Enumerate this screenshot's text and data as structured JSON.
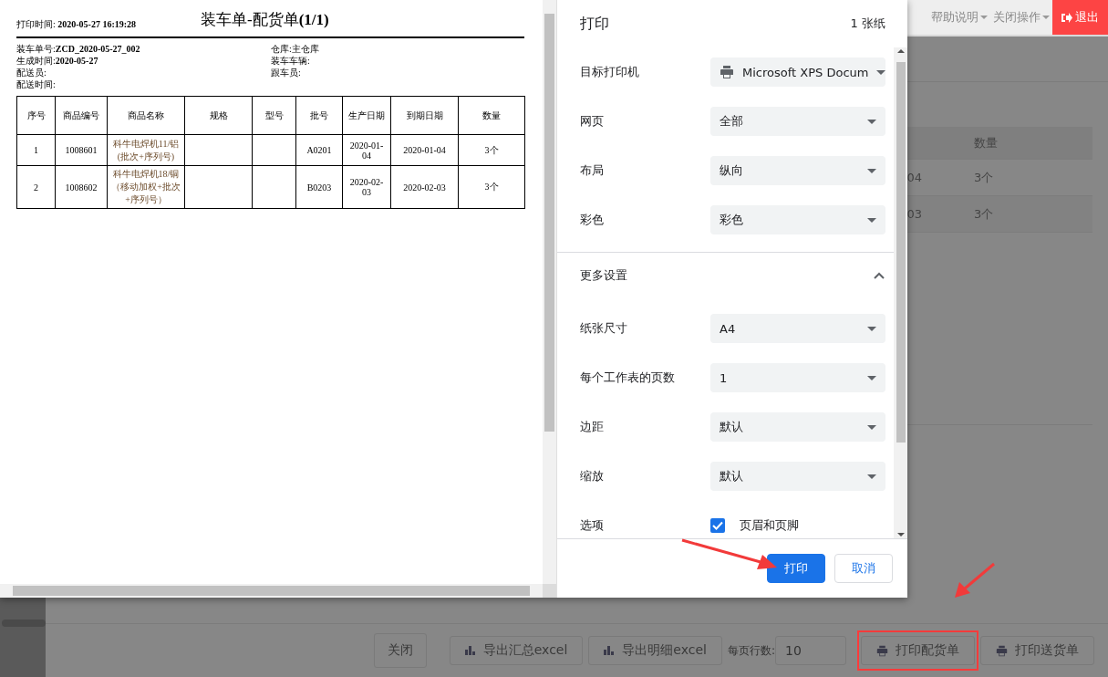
{
  "top_bar": {
    "menus": [
      {
        "label": "帮助说明",
        "dropdown": true
      },
      {
        "label": "关闭操作",
        "dropdown": true
      }
    ],
    "exit": "退出"
  },
  "background_table": {
    "columns": [
      "数量"
    ],
    "rows": [
      {
        "column_1": "04",
        "column_2": "3个"
      },
      {
        "column_1": "03",
        "column_2": "3个"
      }
    ]
  },
  "toolbar": {
    "close": "关闭",
    "export_buttons": [
      "导出汇总excel",
      "导出明细excel"
    ],
    "rows_per_page": {
      "label": "每页行数:",
      "value": "10"
    },
    "print_buttons": [
      {
        "label": "打印配货单",
        "highlighted": true
      },
      {
        "label": "打印送货单",
        "highlighted": false
      }
    ]
  },
  "print_preview": {
    "print_time": "打印时间: **2020-05-27 16:19:28**",
    "title": "装车单-配货单**(1/1)**",
    "info_left": [
      "装车单号:**ZCD_2020-05-27_002**",
      "生成时间:**2020-05-27**",
      "配送员:",
      "配送时间:"
    ],
    "info_right": [
      "仓库:主仓库",
      "装车车辆:",
      "跟车员:"
    ],
    "columns": [
      "序号",
      "商品编号",
      "商品名称",
      "规格",
      "型号",
      "批号",
      "生产日期",
      "到期日期",
      "数量"
    ],
    "rows": [
      {
        "cells": [
          "1",
          "1008601",
          "科牛电焊机11/铝(批次+序列号)",
          null,
          null,
          "A0201",
          "2020-01-04",
          "2020-01-04",
          "3个"
        ]
      },
      {
        "cells": [
          "2",
          "1008602",
          "科牛电焊机18/铜（移动加权+批次+序列号）",
          null,
          null,
          "B0203",
          "2020-02-03",
          "2020-02-03",
          "3个"
        ]
      }
    ]
  },
  "print_dialog": {
    "title": "打印",
    "sheets": "1 张纸",
    "settings": [
      {
        "kind": "printer",
        "label": "目标打印机",
        "value": "Microsoft XPS Docum"
      },
      {
        "kind": "select",
        "label": "网页",
        "value": "全部"
      },
      {
        "kind": "select",
        "label": "布局",
        "value": "纵向"
      },
      {
        "kind": "select",
        "label": "彩色",
        "value": "彩色"
      }
    ],
    "more_settings": {
      "label": "更多设置",
      "expanded": true,
      "settings": [
        {
          "kind": "select",
          "label": "纸张尺寸",
          "value": "A4"
        },
        {
          "kind": "select",
          "label": "每个工作表的页数",
          "value": "1"
        },
        {
          "kind": "select",
          "label": "边距",
          "value": "默认"
        },
        {
          "kind": "select",
          "label": "缩放",
          "value": "默认"
        },
        {
          "kind": "checkbox",
          "label": "选项",
          "value": "页眉和页脚",
          "checked": true
        }
      ]
    },
    "buttons": [
      {
        "kind": "primary",
        "label": "打印"
      },
      {
        "kind": "secondary",
        "label": "取消"
      }
    ]
  }
}
